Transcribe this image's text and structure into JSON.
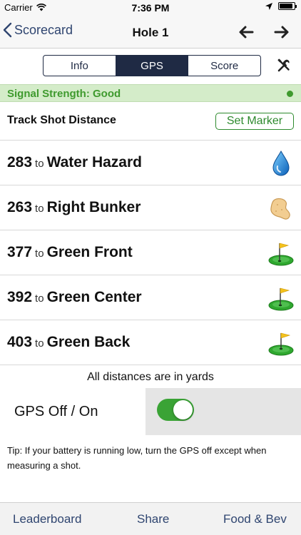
{
  "status": {
    "carrier": "Carrier",
    "time": "7:36 PM",
    "battery_level": 0.9
  },
  "nav": {
    "back_label": "Scorecard",
    "title": "Hole 1",
    "prev_icon": "arrow-left-icon",
    "next_icon": "arrow-right-icon"
  },
  "segments": {
    "selected": "GPS",
    "items": [
      {
        "label": "Info"
      },
      {
        "label": "GPS"
      },
      {
        "label": "Score"
      }
    ],
    "tools_icon": "tools-icon"
  },
  "signal": {
    "text": "Signal Strength: Good",
    "color": "#3f9a2e"
  },
  "track": {
    "label": "Track Shot Distance",
    "button": "Set Marker"
  },
  "distances": {
    "connector": "to",
    "items": [
      {
        "yards": "283",
        "target": "Water Hazard",
        "icon": "water-drop-icon"
      },
      {
        "yards": "263",
        "target": "Right Bunker",
        "icon": "bunker-icon"
      },
      {
        "yards": "377",
        "target": "Green Front",
        "icon": "green-flag-icon"
      },
      {
        "yards": "392",
        "target": "Green Center",
        "icon": "green-flag-icon"
      },
      {
        "yards": "403",
        "target": "Green Back",
        "icon": "green-flag-icon"
      }
    ]
  },
  "units_note": "All distances are in yards",
  "gps": {
    "label": "GPS Off / On",
    "enabled": true,
    "toggle_color": "#3aa335"
  },
  "tip": "Tip: If your battery is running low, turn the GPS off except when measuring a shot.",
  "tabs": [
    {
      "label": "Leaderboard"
    },
    {
      "label": "Share"
    },
    {
      "label": "Food & Bev"
    }
  ],
  "colors": {
    "nav_blue": "#2f4570",
    "segment_dark": "#1f2a44",
    "accent_green": "#2e8a2e"
  }
}
